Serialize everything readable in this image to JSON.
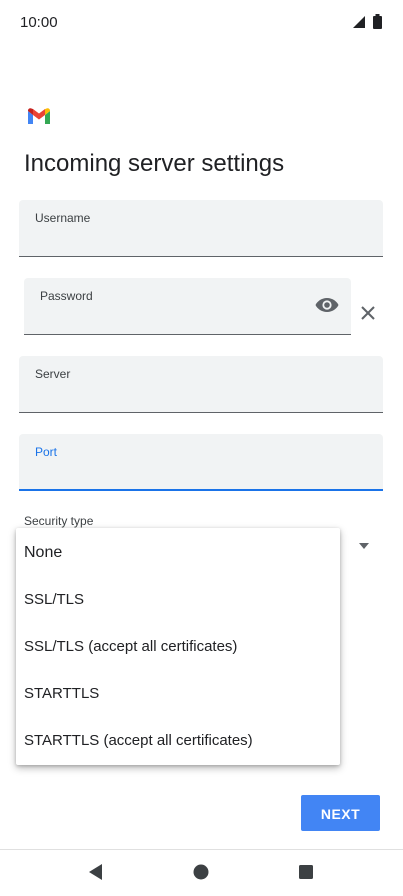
{
  "status_bar": {
    "time": "10:00",
    "icons": [
      "signal-icon",
      "battery-icon"
    ]
  },
  "app": {
    "logo": "gmail-logo"
  },
  "page": {
    "title": "Incoming server settings"
  },
  "fields": {
    "username": {
      "label": "Username",
      "value": ""
    },
    "password": {
      "label": "Password",
      "value": ""
    },
    "server": {
      "label": "Server",
      "value": ""
    },
    "port": {
      "label": "Port",
      "value": "",
      "focused": true
    }
  },
  "security": {
    "label": "Security type",
    "options": [
      "None",
      "SSL/TLS",
      "SSL/TLS (accept all certificates)",
      "STARTTLS",
      "STARTTLS (accept all certificates)"
    ]
  },
  "actions": {
    "next_label": "NEXT"
  },
  "nav": {
    "buttons": [
      "back-icon",
      "home-icon",
      "recents-icon"
    ]
  },
  "colors": {
    "accent": "#1a73e8",
    "button": "#4285f4",
    "field_background": "#f1f3f4",
    "text": "#202124"
  }
}
